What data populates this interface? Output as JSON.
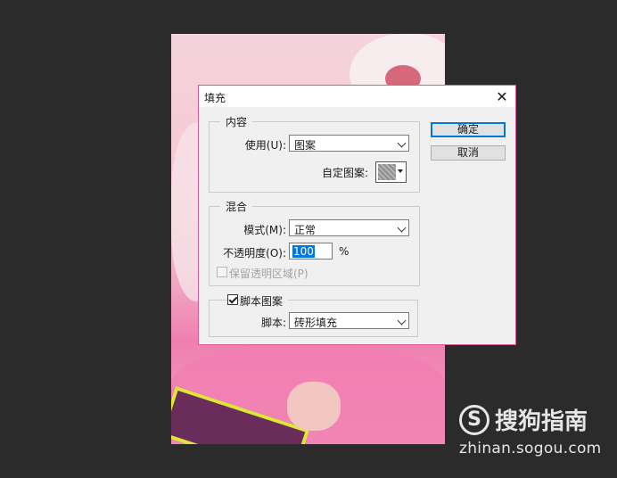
{
  "dialog": {
    "title": "填充",
    "close_symbol": "✕",
    "buttons": {
      "ok": "确定",
      "cancel": "取消"
    },
    "content_group": {
      "legend": "内容",
      "use_label": "使用(U):",
      "use_value": "图案",
      "custom_pattern_label": "自定图案:"
    },
    "blend_group": {
      "legend": "混合",
      "mode_label": "模式(M):",
      "mode_value": "正常",
      "opacity_label": "不透明度(O):",
      "opacity_value": "100",
      "opacity_unit": "%",
      "preserve_transparency_label": "保留透明区域(P)",
      "preserve_transparency_checked": false,
      "preserve_transparency_enabled": false
    },
    "script_group": {
      "checkbox_label": "脚本图案",
      "checkbox_checked": true,
      "script_label": "脚本:",
      "script_value": "砖形填充"
    }
  },
  "watermark": {
    "logo_symbol": "S",
    "brand": "搜狗指南",
    "url": "zhinan.sogou.com"
  },
  "colors": {
    "dialog_border": "#d55d93",
    "primary_button_border": "#0078d7",
    "background": "#2b2b2b"
  }
}
